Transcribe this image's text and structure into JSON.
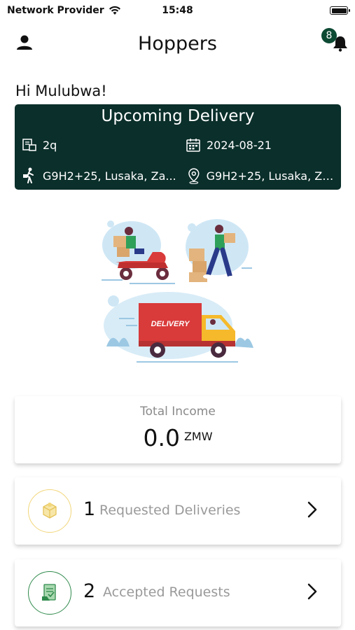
{
  "status_bar": {
    "carrier": "Network Provider",
    "time": "15:48"
  },
  "header": {
    "title": "Hoppers",
    "notification_count": "8"
  },
  "greeting": "Hi Mulubwa!",
  "upcoming_delivery": {
    "title": "Upcoming Delivery",
    "quantity": "2q",
    "date": "2024-08-21",
    "pickup_location": "G9H2+25, Lusaka, Za...",
    "dropoff_location": "G9H2+25, Lusaka, Za..."
  },
  "illustration": {
    "truck_label": "DELIVERY"
  },
  "income": {
    "label": "Total Income",
    "value": "0.0",
    "currency": "ZMW"
  },
  "stats": [
    {
      "count": "1",
      "label": "Requested Deliveries",
      "icon": "delivery-box-icon",
      "color": "#f2d67a"
    },
    {
      "count": "2",
      "label": "Accepted Requests",
      "icon": "accepted-document-icon",
      "color": "#2f8a4c"
    }
  ],
  "colors": {
    "card_dark": "#0b2f2b",
    "badge": "#0d4a34"
  }
}
